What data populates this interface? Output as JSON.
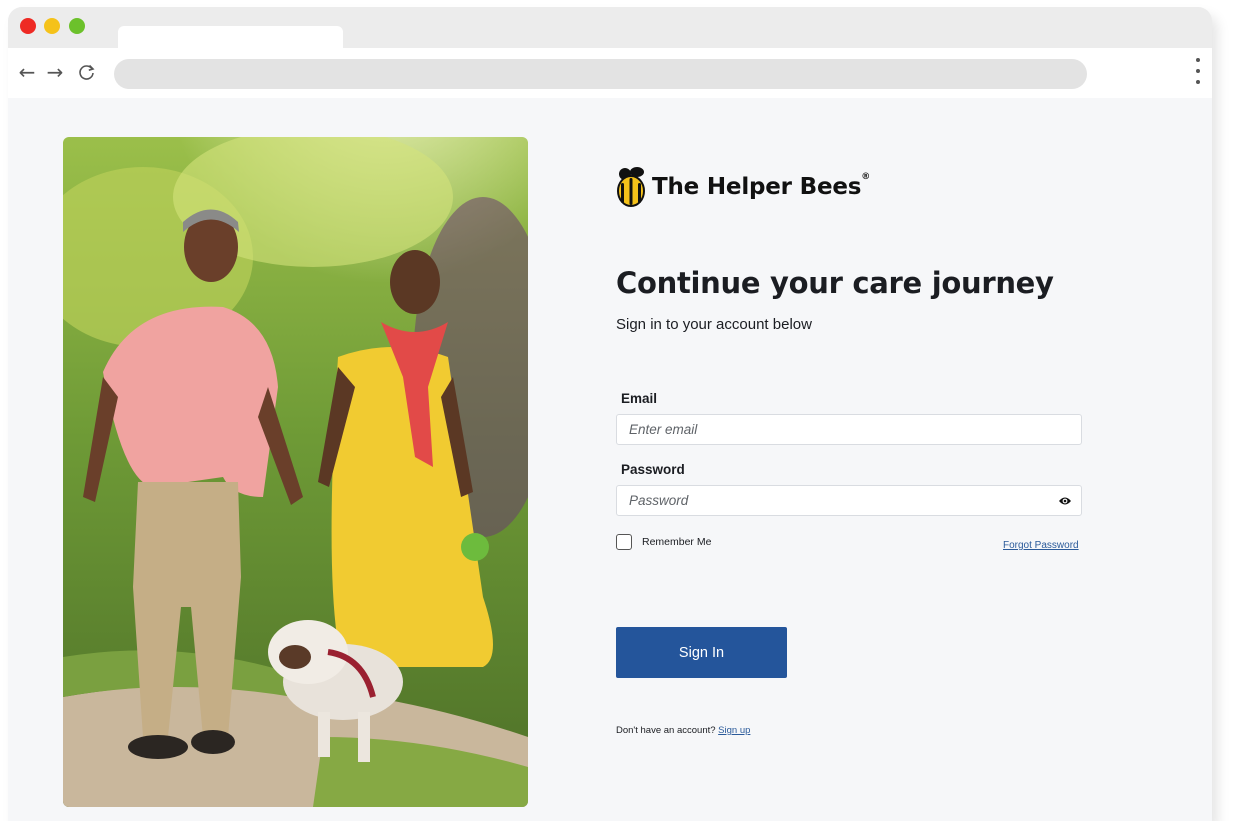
{
  "browser": {
    "tab_title": "",
    "url": "",
    "back_icon": "back-arrow-icon",
    "forward_icon": "forward-arrow-icon",
    "reload_icon": "reload-icon",
    "menu_icon": "kebab-menu-icon"
  },
  "brand": {
    "name": "The Helper Bees",
    "registered": "®",
    "logo_icon": "bee-icon",
    "colors": {
      "bee_yellow": "#f5c21a",
      "bee_black": "#111111"
    }
  },
  "login": {
    "heading": "Continue your care journey",
    "subheading": "Sign in to your account below",
    "email": {
      "label": "Email",
      "placeholder": "Enter email",
      "value": ""
    },
    "password": {
      "label": "Password",
      "placeholder": "Password",
      "value": "",
      "toggle_icon": "eye-icon"
    },
    "remember_label": "Remember Me",
    "remember_checked": false,
    "forgot_label": "Forgot Password",
    "submit_label": "Sign In",
    "signup_prompt": "Don't have an account?",
    "signup_link": "Sign up",
    "colors": {
      "primary": "#24559b",
      "link": "#2a5a9a"
    }
  },
  "hero_image": {
    "description_icon": "photo"
  }
}
